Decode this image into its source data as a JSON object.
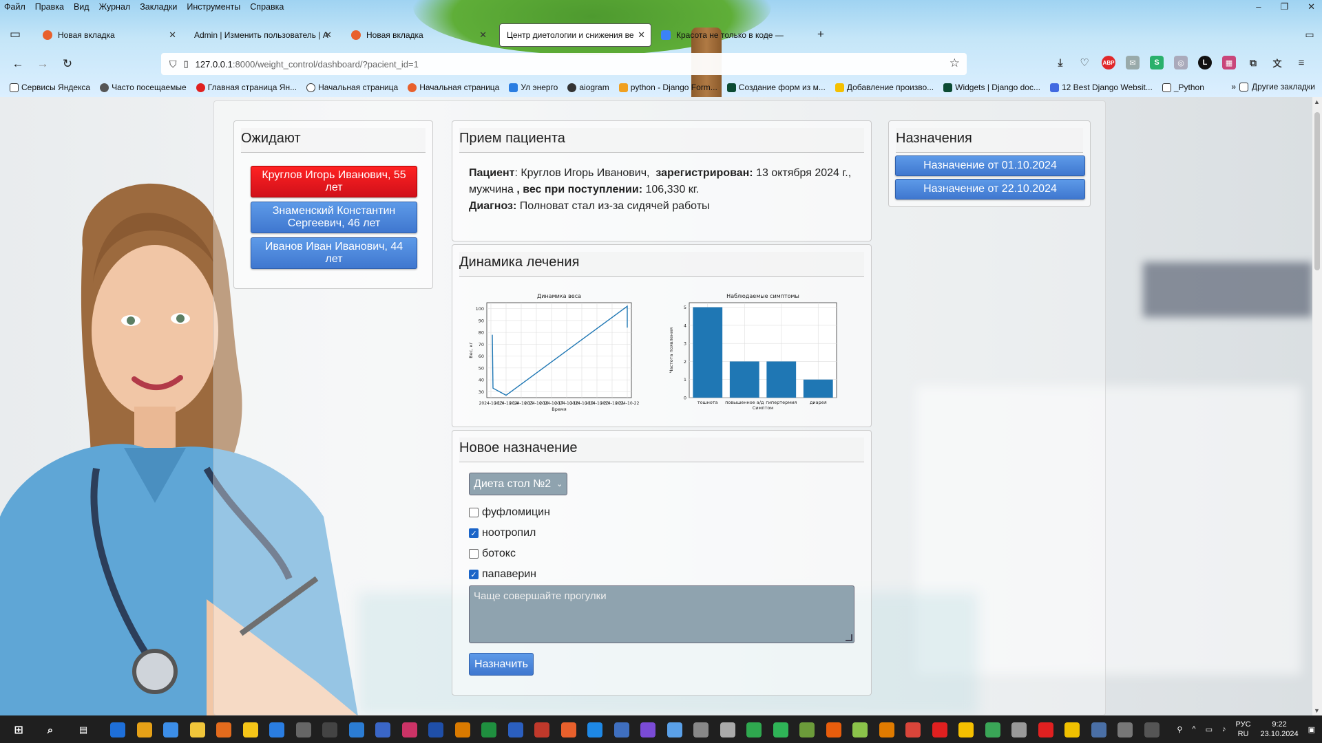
{
  "menubar": [
    "Файл",
    "Правка",
    "Вид",
    "Журнал",
    "Закладки",
    "Инструменты",
    "Справка"
  ],
  "window_controls": [
    "–",
    "❐",
    "✕"
  ],
  "tabs": [
    {
      "title": "Новая вкладка",
      "color": "#e8602c"
    },
    {
      "title": "Admin | Изменить пользователь | А",
      "color": ""
    },
    {
      "title": "Новая вкладка",
      "color": "#e8602c"
    },
    {
      "title": "Центр диетологии и снижения вес",
      "color": ""
    },
    {
      "title": "Красота не только в коде —",
      "color": "#3b82f6"
    }
  ],
  "address": {
    "host": "127.0.0.1",
    "rest": ":8000/weight_control/dashboard/?pacient_id=1"
  },
  "bookmarks": [
    {
      "label": "Сервисы Яндекса",
      "color": "#fff"
    },
    {
      "label": "Часто посещаемые",
      "color": "#fff"
    },
    {
      "label": "Главная страница Ян...",
      "color": "#e02020"
    },
    {
      "label": "Начальная страница",
      "color": "#fff"
    },
    {
      "label": "Начальная страница",
      "color": "#e8602c"
    },
    {
      "label": "Ул энерго",
      "color": "#2a7de1"
    },
    {
      "label": "aiogram",
      "color": "#333"
    },
    {
      "label": "python - Django Form...",
      "color": "#f0a020"
    },
    {
      "label": "Создание форм из м...",
      "color": "#0c4b33"
    },
    {
      "label": "Добавление произво...",
      "color": "#f5c000"
    },
    {
      "label": "Widgets | Django doc...",
      "color": "#0c4b33"
    },
    {
      "label": "12 Best Django Websit...",
      "color": "#4169e1"
    },
    {
      "label": "_Python",
      "color": "#fff"
    }
  ],
  "bookmarks_other": "Другие закладки",
  "waiting": {
    "title": "Ожидают",
    "patients": [
      {
        "label": "Круглов Игорь Иванович, 55 лет",
        "active": true
      },
      {
        "label": "Знаменский Константин Сергеевич, 46 лет",
        "active": false
      },
      {
        "label": "Иванов Иван Иванович, 44 лет",
        "active": false
      }
    ]
  },
  "reception": {
    "title": "Прием пациента",
    "patient_label": "Пациент",
    "patient_name": "Круглов Игорь Иванович,",
    "registered_label": "зарегистрирован:",
    "registered_date": "13 октября 2024 г.,",
    "sex": "мужчина",
    "weight_label": ", вес при поступлении:",
    "weight_value": "106,330 кг.",
    "diagnosis_label": "Диагноз:",
    "diagnosis_value": "Полноват стал из-за сидячей работы"
  },
  "dynamics": {
    "title": "Динамика лечения"
  },
  "chart_data": [
    {
      "type": "line",
      "title": "Динамика веса",
      "xlabel": "Время",
      "ylabel": "Вес, кг",
      "x_ticks": [
        "2024-10-13",
        "2024-10-14",
        "2024-10-15",
        "2024-10-16",
        "2024-10-17",
        "2024-10-18",
        "2024-10-19",
        "2024-10-20",
        "2024-10-21",
        "2024-10-22"
      ],
      "ylim": [
        25,
        105
      ],
      "yticks": [
        30,
        40,
        50,
        60,
        70,
        80,
        90,
        100
      ],
      "grid": true,
      "points": [
        {
          "x": "2024-10-13",
          "y": 78
        },
        {
          "x": "2024-10-13",
          "y": 33
        },
        {
          "x": "2024-10-14",
          "y": 27
        },
        {
          "x": "2024-10-22",
          "y": 102
        },
        {
          "x": "2024-10-22",
          "y": 84
        }
      ],
      "color": "#1f77b4"
    },
    {
      "type": "bar",
      "title": "Наблюдаемые симптомы",
      "xlabel": "Симптом",
      "ylabel": "Частота появления",
      "categories": [
        "тошнота",
        "повышенное а/д",
        "гипертермия",
        "диарея"
      ],
      "values": [
        5,
        2,
        2,
        1
      ],
      "ylim": [
        0,
        5.25
      ],
      "yticks": [
        0,
        1,
        2,
        3,
        4,
        5
      ],
      "grid": true,
      "color": "#1f77b4"
    }
  ],
  "new_prescription": {
    "title": "Новое назначение",
    "diet_selected": "Диета стол №2",
    "drugs": [
      {
        "label": "фуфломицин",
        "checked": false
      },
      {
        "label": "ноотропил",
        "checked": true
      },
      {
        "label": "ботокс",
        "checked": false
      },
      {
        "label": "папаверин",
        "checked": true
      }
    ],
    "notes": "Чаще совершайте прогулки",
    "submit_label": "Назначить"
  },
  "prescriptions": {
    "title": "Назначения",
    "items": [
      "Назначение от 01.10.2024",
      "Назначение от 22.10.2024"
    ]
  },
  "tray": {
    "lang_top": "РУС",
    "lang_bottom": "RU",
    "time": "9:22",
    "date": "23.10.2024"
  },
  "colors": {
    "accent_blue": "#3f77cf",
    "active_red": "#d0101a",
    "chart_blue": "#1f77b4"
  }
}
